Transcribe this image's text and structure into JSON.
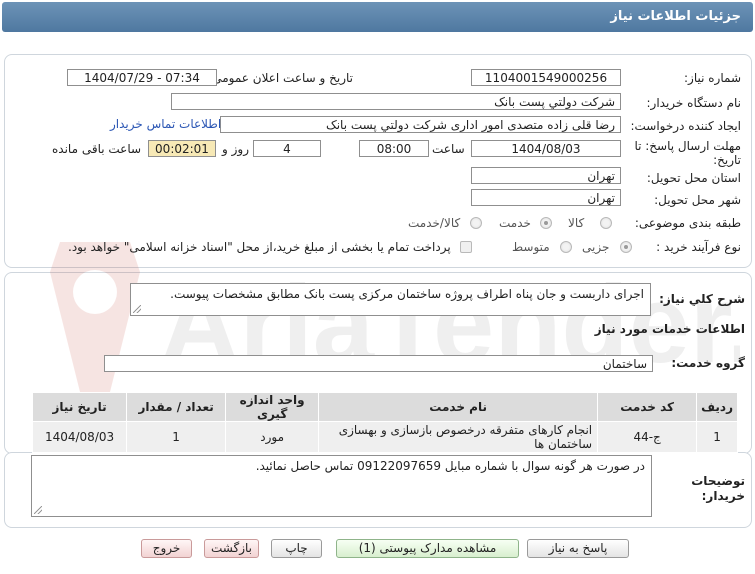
{
  "header": {
    "title": "جزئیات اطلاعات نیاز"
  },
  "fields": {
    "need_number_label": "شماره نیاز:",
    "need_number": "1104001549000256",
    "announce_label": "تاریخ و ساعت اعلان عمومی:",
    "announce_value": "1404/07/29 - 07:34",
    "buyer_org_label": "نام دستگاه خریدار:",
    "buyer_org": "شرکت دولتي پست بانک",
    "creator_label": "ایجاد کننده درخواست:",
    "creator": "رضا قلی زاده متصدی امور اداری شرکت دولتي پست بانک",
    "contact_link": "اطلاعات تماس خریدار",
    "deadline_label_1": "مهلت ارسال پاسخ: تا",
    "deadline_label_2": "تاریخ:",
    "deadline_date": "1404/08/03",
    "time_label": "ساعت",
    "deadline_time": "08:00",
    "days": "4",
    "days_label": "روز و",
    "remaining": "00:02:01",
    "remaining_label": "ساعت باقی مانده",
    "province_label": "استان محل تحویل:",
    "province": "تهران",
    "city_label": "شهر محل تحویل:",
    "city": "تهران",
    "category_label": "طبقه بندی موضوعی:",
    "category_options": [
      "کالا",
      "خدمت",
      "کالا/خدمت"
    ],
    "process_label": "نوع فرآیند خرید :",
    "process_options": [
      "جزیی",
      "متوسط"
    ],
    "payment_note": "پرداخت تمام یا بخشی از مبلغ خرید،از محل \"اسناد خزانه اسلامی\" خواهد بود."
  },
  "summary": {
    "label": "شرح کلي نیاز:",
    "text": "اجرای داربست و جان پناه اطراف پروژه ساختمان مرکزی پست بانک مطابق مشخصات پیوست."
  },
  "services": {
    "section_title": "اطلاعات خدمات مورد نیاز",
    "group_label": "گروه خدمت:",
    "group_value": "ساختمان",
    "table": {
      "headers": [
        "ردیف",
        "کد خدمت",
        "نام خدمت",
        "واحد اندازه گیری",
        "تعداد / مقدار",
        "تاریخ نیاز"
      ],
      "rows": [
        [
          "1",
          "ج-44",
          "انجام کارهای متفرقه درخصوص بازسازی و بهسازی ساختمان ها",
          "مورد",
          "1",
          "1404/08/03"
        ]
      ]
    }
  },
  "description": {
    "label_1": "توضیحات",
    "label_2": "خریدار:",
    "text": "در صورت هر گونه سوال با شماره مبایل 09122097659 تماس حاصل نمائید."
  },
  "watermark": "AriaTender.net",
  "buttons": {
    "reply": "پاسخ به نیاز",
    "view_docs": "مشاهده مدارک پیوستی (1)",
    "print": "چاپ",
    "back": "بازگشت",
    "exit": "خروج"
  }
}
